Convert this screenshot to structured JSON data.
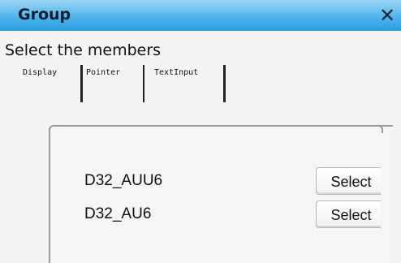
{
  "window": {
    "title": "Group",
    "close_glyph": "✕"
  },
  "instruction": "Select the members",
  "tabs": [
    {
      "label": "Display"
    },
    {
      "label": "Pointer"
    },
    {
      "label": "TextInput"
    }
  ],
  "members": [
    {
      "name": "D32_AUU6",
      "action_label": "Select"
    },
    {
      "name": "D32_AU6",
      "action_label": "Select"
    }
  ]
}
